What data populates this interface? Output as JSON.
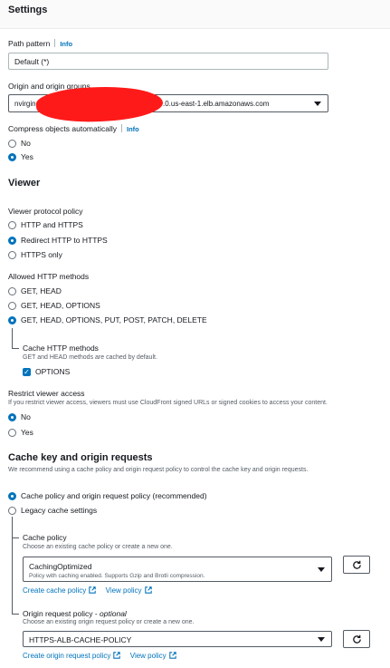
{
  "settings": {
    "title": "Settings",
    "path_pattern": {
      "label": "Path pattern",
      "info": "Info",
      "value": "Default (*)"
    },
    "origin": {
      "label": "Origin and origin groups",
      "value_prefix": "nvirgin",
      "value_suffix": ".0.us-east-1.elb.amazonaws.com"
    },
    "compress": {
      "label": "Compress objects automatically",
      "info": "Info",
      "options": [
        "No",
        "Yes"
      ],
      "selected": "Yes"
    }
  },
  "viewer": {
    "title": "Viewer",
    "protocol_policy": {
      "label": "Viewer protocol policy",
      "options": [
        "HTTP and HTTPS",
        "Redirect HTTP to HTTPS",
        "HTTPS only"
      ],
      "selected": "Redirect HTTP to HTTPS"
    },
    "allowed_methods": {
      "label": "Allowed HTTP methods",
      "options": [
        "GET, HEAD",
        "GET, HEAD, OPTIONS",
        "GET, HEAD, OPTIONS, PUT, POST, PATCH, DELETE"
      ],
      "selected": "GET, HEAD, OPTIONS, PUT, POST, PATCH, DELETE"
    },
    "cache_methods": {
      "label": "Cache HTTP methods",
      "description": "GET and HEAD methods are cached by default.",
      "checkbox_label": "OPTIONS",
      "checked": true
    },
    "restrict_access": {
      "label": "Restrict viewer access",
      "description": "If you restrict viewer access, viewers must use CloudFront signed URLs or signed cookies to access your content.",
      "options": [
        "No",
        "Yes"
      ],
      "selected": "No"
    }
  },
  "cache_key": {
    "title": "Cache key and origin requests",
    "description": "We recommend using a cache policy and origin request policy to control the cache key and origin requests.",
    "options": [
      "Cache policy and origin request policy (recommended)",
      "Legacy cache settings"
    ],
    "selected": "Cache policy and origin request policy (recommended)",
    "cache_policy": {
      "label": "Cache policy",
      "description": "Choose an existing cache policy or create a new one.",
      "selected_name": "CachingOptimized",
      "selected_description": "Policy with caching enabled. Supports Gzip and Brotli compression.",
      "create_link": "Create cache policy",
      "view_link": "View policy"
    },
    "origin_request_policy": {
      "label": "Origin request policy - ",
      "label_optional": "optional",
      "description": "Choose an existing origin request policy or create a new one.",
      "selected_name": "HTTPS-ALB-CACHE-POLICY",
      "create_link": "Create origin request policy",
      "view_link": "View policy"
    }
  },
  "colors": {
    "accent": "#0073bb",
    "redaction": "#ff1a1a",
    "text": "#16191f"
  }
}
